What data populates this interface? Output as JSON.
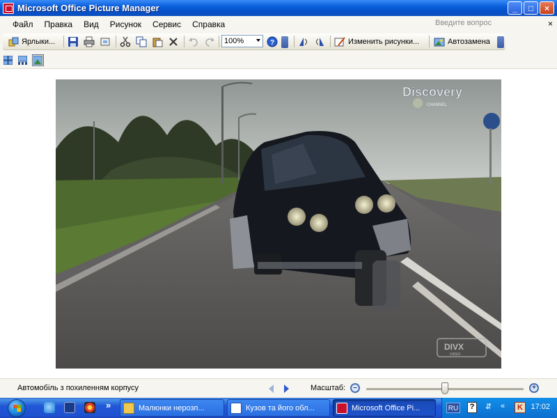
{
  "window": {
    "title": "Microsoft Office Picture Manager",
    "controls": [
      "_",
      "□",
      "×"
    ]
  },
  "menu": {
    "items": [
      "Файл",
      "Правка",
      "Вид",
      "Рисунок",
      "Сервис",
      "Справка"
    ],
    "help_placeholder": "Введите вопрос",
    "close_glyph": "×"
  },
  "toolbar": {
    "shortcuts_label": "Ярлыки...",
    "zoom_value": "100%",
    "edit_picture_label": "Изменить рисунки...",
    "autocorrect_label": "Автозамена"
  },
  "photo": {
    "channel_logo": "Discovery",
    "channel_sub": "CHANNEL",
    "watermark": "DIVX",
    "watermark_sub": "VIDEO"
  },
  "status": {
    "caption": "Автомобіль з похиленням корпусу",
    "zoom_label": "Масштаб:",
    "zoom_level": 0.5
  },
  "taskbar": {
    "tasks": [
      {
        "label": "Малюнки нерозп...",
        "active": false
      },
      {
        "label": "Кузов та його обл...",
        "active": false
      },
      {
        "label": "Microsoft Office Pi...",
        "active": true
      }
    ],
    "chevron": "»",
    "lang": "RU",
    "time": "17:02"
  },
  "colors": {
    "title_bar": "#0a5fdc",
    "taskbar": "#2157d7",
    "tray": "#0f7fdc"
  }
}
